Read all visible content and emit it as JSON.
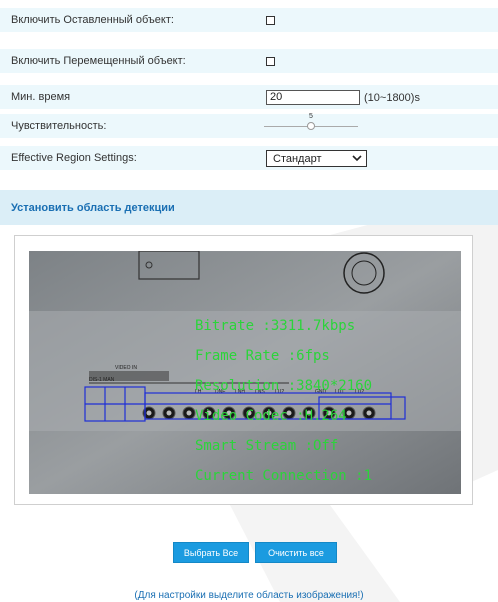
{
  "settings": {
    "rows": [
      {
        "label": "Включить Оставленный объект:",
        "checked": false
      },
      {
        "label": "Включить Перемещенный объект:",
        "checked": false
      }
    ],
    "min_time": {
      "label": "Мин. время",
      "value": "20",
      "range": "(10~1800)s"
    },
    "sensitivity": {
      "label": "Чувствительность:",
      "value": "5",
      "level": 5,
      "min": 0,
      "max": 10
    },
    "region": {
      "label": "Effective Region Settings:",
      "selected": "Стандарт"
    }
  },
  "section": {
    "title": "Установить область детекции"
  },
  "video": {
    "osd_lines": [
      "Bitrate :3311.7kbps",
      "Frame Rate :6fps",
      "Resolution :3840*2160",
      "Video Codec :H.264",
      "Smart Stream :Off",
      "Current Connection :1"
    ],
    "panel_labels": [
      "VIDEO IN",
      "DIS-1 MAN",
      "LH",
      "DNE",
      "LNH",
      "LNS",
      "LU2",
      "GND",
      "LU1",
      "LU2"
    ]
  },
  "actions": {
    "select_all": "Выбрать Все",
    "clear_all": "Очистить все"
  },
  "hint": "(Для настройки выделите область изображения!)",
  "colors": {
    "accent": "#1b9be0",
    "row_bg": "#ecf8fc",
    "header_bg": "#dbeef7",
    "osd": "#2bd43a",
    "grid": "#1f2fd6"
  }
}
